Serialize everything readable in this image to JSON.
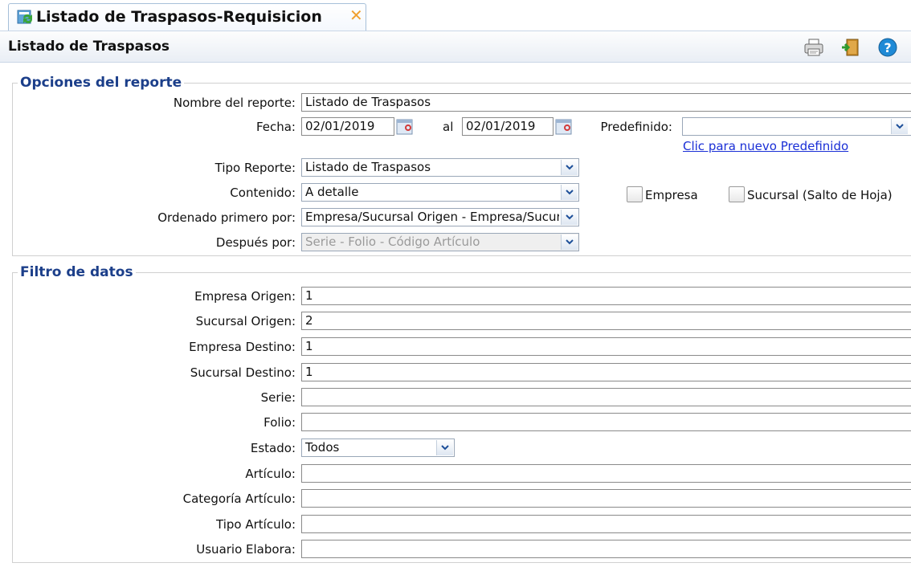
{
  "tab": {
    "title": "Listado de Traspasos-Requisicion",
    "close_glyph": "✕",
    "icon": "report-refresh-icon"
  },
  "header": {
    "title": "Listado de Traspasos",
    "toolbar": {
      "print_icon": "printer-icon",
      "exit_icon": "exit-door-icon",
      "help_icon": "help-icon"
    }
  },
  "report_options": {
    "legend": "Opciones del reporte",
    "report_name": {
      "label": "Nombre del reporte:",
      "value": "Listado de Traspasos"
    },
    "date": {
      "label": "Fecha:",
      "from": "02/01/2019",
      "to_label": "al",
      "to": "02/01/2019"
    },
    "predefined": {
      "label": "Predefinido:",
      "value": "",
      "new_link": "Clic para nuevo Predefinido"
    },
    "report_type": {
      "label": "Tipo Reporte:",
      "value": "Listado de Traspasos"
    },
    "content": {
      "label": "Contenido:",
      "value": "A detalle"
    },
    "order_first": {
      "label": "Ordenado primero por:",
      "value": "Empresa/Sucursal Origen - Empresa/Sucursal Destino"
    },
    "order_then": {
      "label": "Después por:",
      "value": "Serie - Folio - Código Artículo"
    },
    "check_company": {
      "label": "Empresa",
      "checked": false
    },
    "check_branch": {
      "label": "Sucursal (Salto de Hoja)",
      "checked": false
    }
  },
  "data_filter": {
    "legend": "Filtro de datos",
    "origin_company": {
      "label": "Empresa Origen:",
      "value": "1"
    },
    "origin_branch": {
      "label": "Sucursal Origen:",
      "value": "2"
    },
    "dest_company": {
      "label": "Empresa Destino:",
      "value": "1"
    },
    "dest_branch": {
      "label": "Sucursal Destino:",
      "value": "1"
    },
    "series": {
      "label": "Serie:",
      "value": ""
    },
    "folio": {
      "label": "Folio:",
      "value": ""
    },
    "status": {
      "label": "Estado:",
      "value": "Todos"
    },
    "article": {
      "label": "Artículo:",
      "value": ""
    },
    "article_category": {
      "label": "Categoría Artículo:",
      "value": ""
    },
    "article_type": {
      "label": "Tipo Artículo:",
      "value": ""
    },
    "created_by": {
      "label": "Usuario Elabora:",
      "value": ""
    }
  },
  "colors": {
    "legend": "#1c3f8a",
    "link": "#1a2fd6",
    "close": "#f0a030",
    "help": "#1f8ad6"
  }
}
